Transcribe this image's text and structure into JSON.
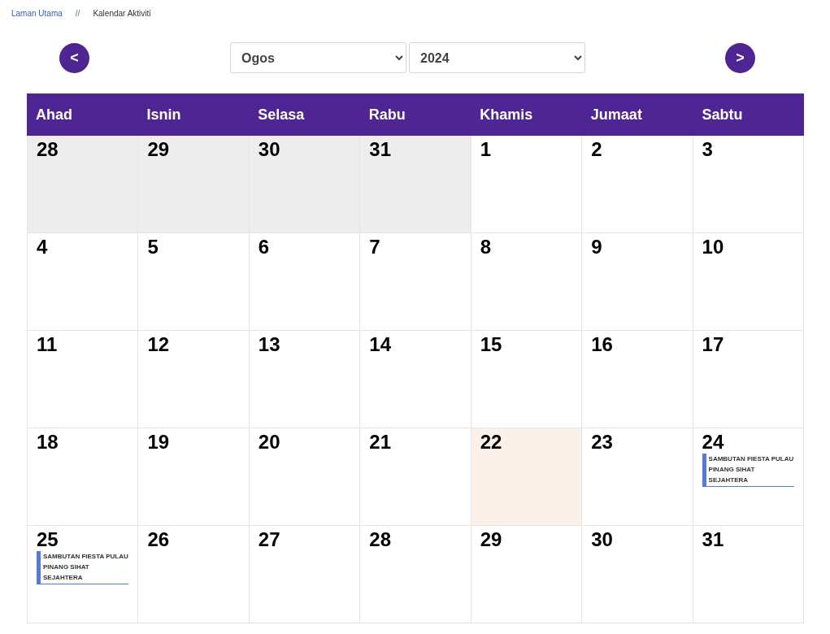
{
  "breadcrumb": [
    {
      "label": "Laman Utama",
      "kind": "link"
    },
    {
      "label": "//",
      "kind": "separator"
    },
    {
      "label": "Kalendar Aktiviti",
      "kind": "current"
    }
  ],
  "nav": {
    "prev": "<",
    "month": "Ogos",
    "year": "2024",
    "next": ">"
  },
  "weekdays": [
    "Ahad",
    "Isnin",
    "Selasa",
    "Rabu",
    "Khamis",
    "Jumaat",
    "Sabtu"
  ],
  "weeks": [
    [
      {
        "day": "28",
        "outside": true,
        "today": false
      },
      {
        "day": "29",
        "outside": true,
        "today": false
      },
      {
        "day": "30",
        "outside": true,
        "today": false
      },
      {
        "day": "31",
        "outside": true,
        "today": false
      },
      {
        "day": "1",
        "outside": false,
        "today": false
      },
      {
        "day": "2",
        "outside": false,
        "today": false
      },
      {
        "day": "3",
        "outside": false,
        "today": false
      }
    ],
    [
      {
        "day": "4",
        "outside": false,
        "today": false
      },
      {
        "day": "5",
        "outside": false,
        "today": false
      },
      {
        "day": "6",
        "outside": false,
        "today": false
      },
      {
        "day": "7",
        "outside": false,
        "today": false
      },
      {
        "day": "8",
        "outside": false,
        "today": false
      },
      {
        "day": "9",
        "outside": false,
        "today": false
      },
      {
        "day": "10",
        "outside": false,
        "today": false
      }
    ],
    [
      {
        "day": "11",
        "outside": false,
        "today": false
      },
      {
        "day": "12",
        "outside": false,
        "today": false
      },
      {
        "day": "13",
        "outside": false,
        "today": false
      },
      {
        "day": "14",
        "outside": false,
        "today": false
      },
      {
        "day": "15",
        "outside": false,
        "today": false
      },
      {
        "day": "16",
        "outside": false,
        "today": false
      },
      {
        "day": "17",
        "outside": false,
        "today": false
      }
    ],
    [
      {
        "day": "18",
        "outside": false,
        "today": false
      },
      {
        "day": "19",
        "outside": false,
        "today": false
      },
      {
        "day": "20",
        "outside": false,
        "today": false
      },
      {
        "day": "21",
        "outside": false,
        "today": false
      },
      {
        "day": "22",
        "outside": false,
        "today": true
      },
      {
        "day": "23",
        "outside": false,
        "today": false
      },
      {
        "day": "24",
        "outside": false,
        "today": false,
        "events": [
          "SAMBUTAN FIESTA PULAU PINANG SIHAT SEJAHTERA"
        ]
      }
    ],
    [
      {
        "day": "25",
        "outside": false,
        "today": false,
        "events": [
          "SAMBUTAN FIESTA PULAU PINANG SIHAT SEJAHTERA"
        ]
      },
      {
        "day": "26",
        "outside": false,
        "today": false
      },
      {
        "day": "27",
        "outside": false,
        "today": false
      },
      {
        "day": "28",
        "outside": false,
        "today": false
      },
      {
        "day": "29",
        "outside": false,
        "today": false
      },
      {
        "day": "30",
        "outside": false,
        "today": false
      },
      {
        "day": "31",
        "outside": false,
        "today": false
      }
    ]
  ]
}
